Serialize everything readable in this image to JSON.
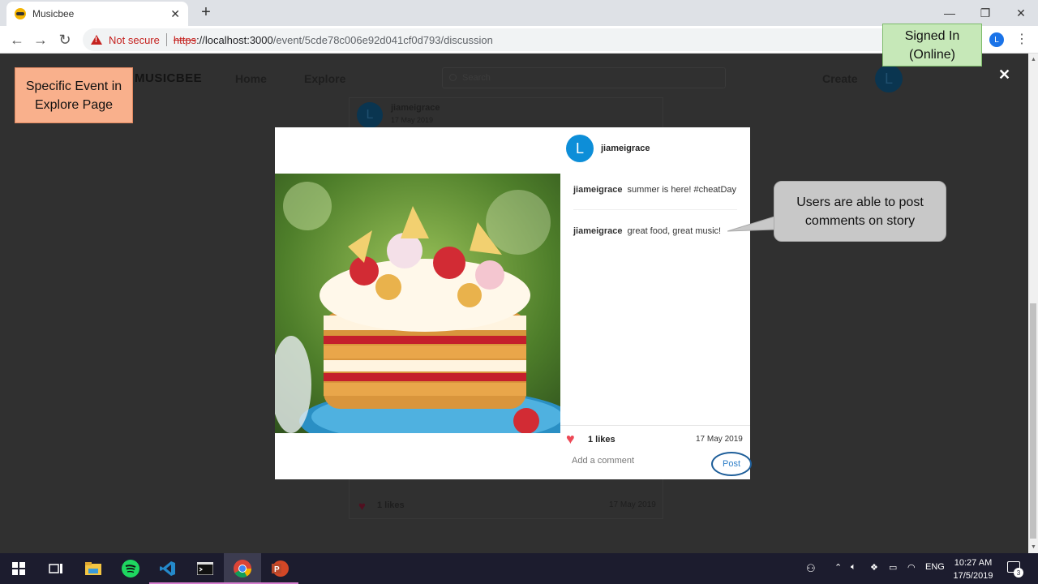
{
  "browser": {
    "tab_title": "Musicbee",
    "url_scheme": "https",
    "url_host": "://localhost:3000",
    "url_path": "/event/5cde78c006e92d041cf0d793/discussion",
    "security_label": "Not secure",
    "profile_initial": "L"
  },
  "site": {
    "logo": "MUSICBEE",
    "nav_home": "Home",
    "nav_explore": "Explore",
    "search_placeholder": "Search",
    "nav_create": "Create",
    "avatar_initial": "L"
  },
  "background_post": {
    "avatar_initial": "L",
    "username": "jiameigrace",
    "date": "17 May 2019",
    "likes": "1 likes",
    "like_date": "17 May 2019"
  },
  "modal": {
    "avatar_initial": "L",
    "username": "jiameigrace",
    "comments": [
      {
        "user": "jiameigrace",
        "text": "summer is here! #cheatDay"
      },
      {
        "user": "jiameigrace",
        "text": "great food, great music!"
      }
    ],
    "likes": "1 likes",
    "date": "17 May 2019",
    "comment_placeholder": "Add a comment",
    "post_label": "Post",
    "close_glyph": "✕"
  },
  "annotations": {
    "specific_event": "Specific Event in Explore Page",
    "signed_in": "Signed In (Online)",
    "users_comment": "Users are able to post comments on story"
  },
  "taskbar": {
    "lang": "ENG",
    "time": "10:27 AM",
    "date": "17/5/2019",
    "notifications": "3"
  }
}
